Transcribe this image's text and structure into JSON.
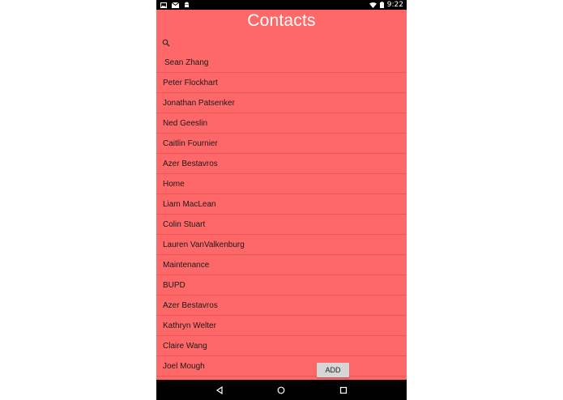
{
  "status_bar": {
    "time": "9:22",
    "icons_left": [
      "image-icon",
      "mail-icon",
      "android-icon"
    ],
    "icons_right": [
      "wifi-icon",
      "battery-icon"
    ]
  },
  "header": {
    "title": "Contacts"
  },
  "search": {
    "icon": "search-icon",
    "placeholder": ""
  },
  "contacts": [
    "Sean Zhang",
    "Peter Flockhart",
    "Jonathan Patsenker",
    "Ned Geeslin",
    "Caitlin Fournier",
    "Azer Bestavros",
    "Home",
    "Liam MacLean",
    "Colin Stuart",
    "Lauren VanValkenburg",
    "Maintenance",
    "BUPD",
    "Azer Bestavros",
    "Kathryn Welter",
    "Claire Wang",
    "Joel Mough"
  ],
  "actions": {
    "add_label": "ADD"
  },
  "nav_bar": {
    "icons": [
      "back-icon",
      "home-icon",
      "recents-icon"
    ]
  },
  "colors": {
    "background": "#ff6868",
    "divider": "#ee5656",
    "title": "#ffffff"
  }
}
